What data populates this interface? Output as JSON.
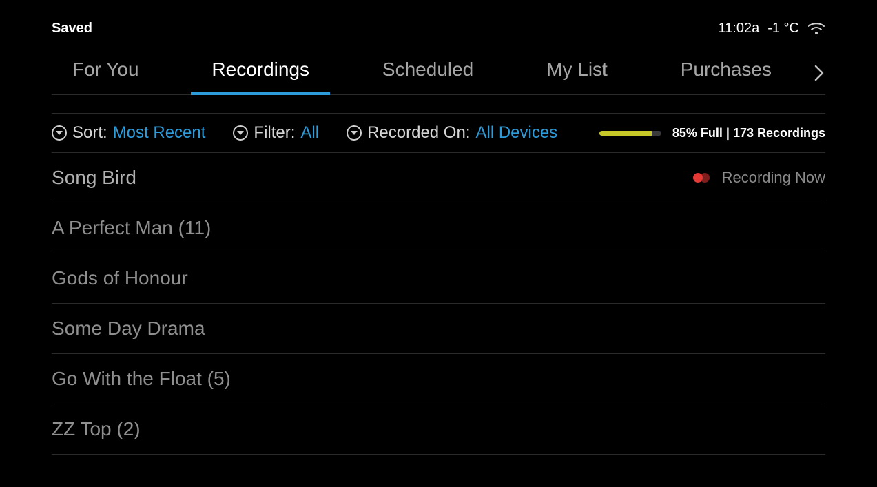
{
  "header": {
    "title": "Saved",
    "time": "11:02a",
    "temperature": "-1 °C"
  },
  "tabs": {
    "for_you": "For You",
    "recordings": "Recordings",
    "scheduled": "Scheduled",
    "my_list": "My List",
    "purchases": "Purchases"
  },
  "filters": {
    "sort": {
      "label": "Sort:",
      "value": "Most Recent"
    },
    "filter": {
      "label": "Filter:",
      "value": "All"
    },
    "recorded_on": {
      "label": "Recorded On:",
      "value": "All Devices"
    },
    "capacity_percent": 85,
    "capacity_text": "85% Full | 173 Recordings"
  },
  "recordings": [
    {
      "title": "Song Bird",
      "badge": "Recording Now"
    },
    {
      "title": "A Perfect Man (11)",
      "badge": ""
    },
    {
      "title": "Gods of Honour",
      "badge": ""
    },
    {
      "title": "Some Day Drama",
      "badge": ""
    },
    {
      "title": "Go With the Float (5)",
      "badge": ""
    },
    {
      "title": "ZZ Top (2)",
      "badge": ""
    }
  ]
}
